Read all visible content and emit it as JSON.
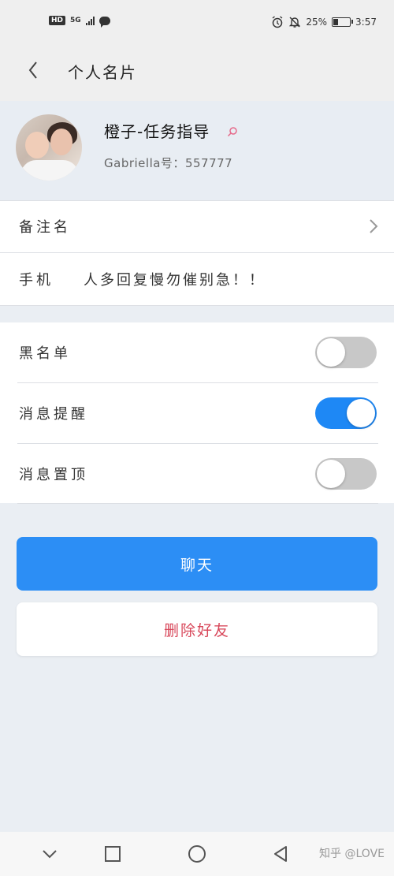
{
  "status_bar": {
    "network_badge": "HD",
    "signal_type": "5G",
    "battery_percent": "25%",
    "battery_level": 0.25,
    "time": "3:57"
  },
  "header": {
    "title": "个人名片"
  },
  "profile": {
    "nickname": "橙子-任务指导",
    "user_id_label": "Gabriella号：",
    "user_id": "557777"
  },
  "remark_row": {
    "label": "备注名"
  },
  "phone_row": {
    "label": "手机",
    "value": "人多回复慢勿催别急！！"
  },
  "settings": [
    {
      "label": "黑名单",
      "enabled": false
    },
    {
      "label": "消息提醒",
      "enabled": true
    },
    {
      "label": "消息置顶",
      "enabled": false
    }
  ],
  "buttons": {
    "chat": "聊天",
    "delete": "删除好友"
  },
  "watermark": "知乎 @LOVE",
  "colors": {
    "accent": "#2c8ef5",
    "toggle_on": "#1e88f5",
    "danger": "#d8475a",
    "page_bg": "#eaeef3"
  }
}
